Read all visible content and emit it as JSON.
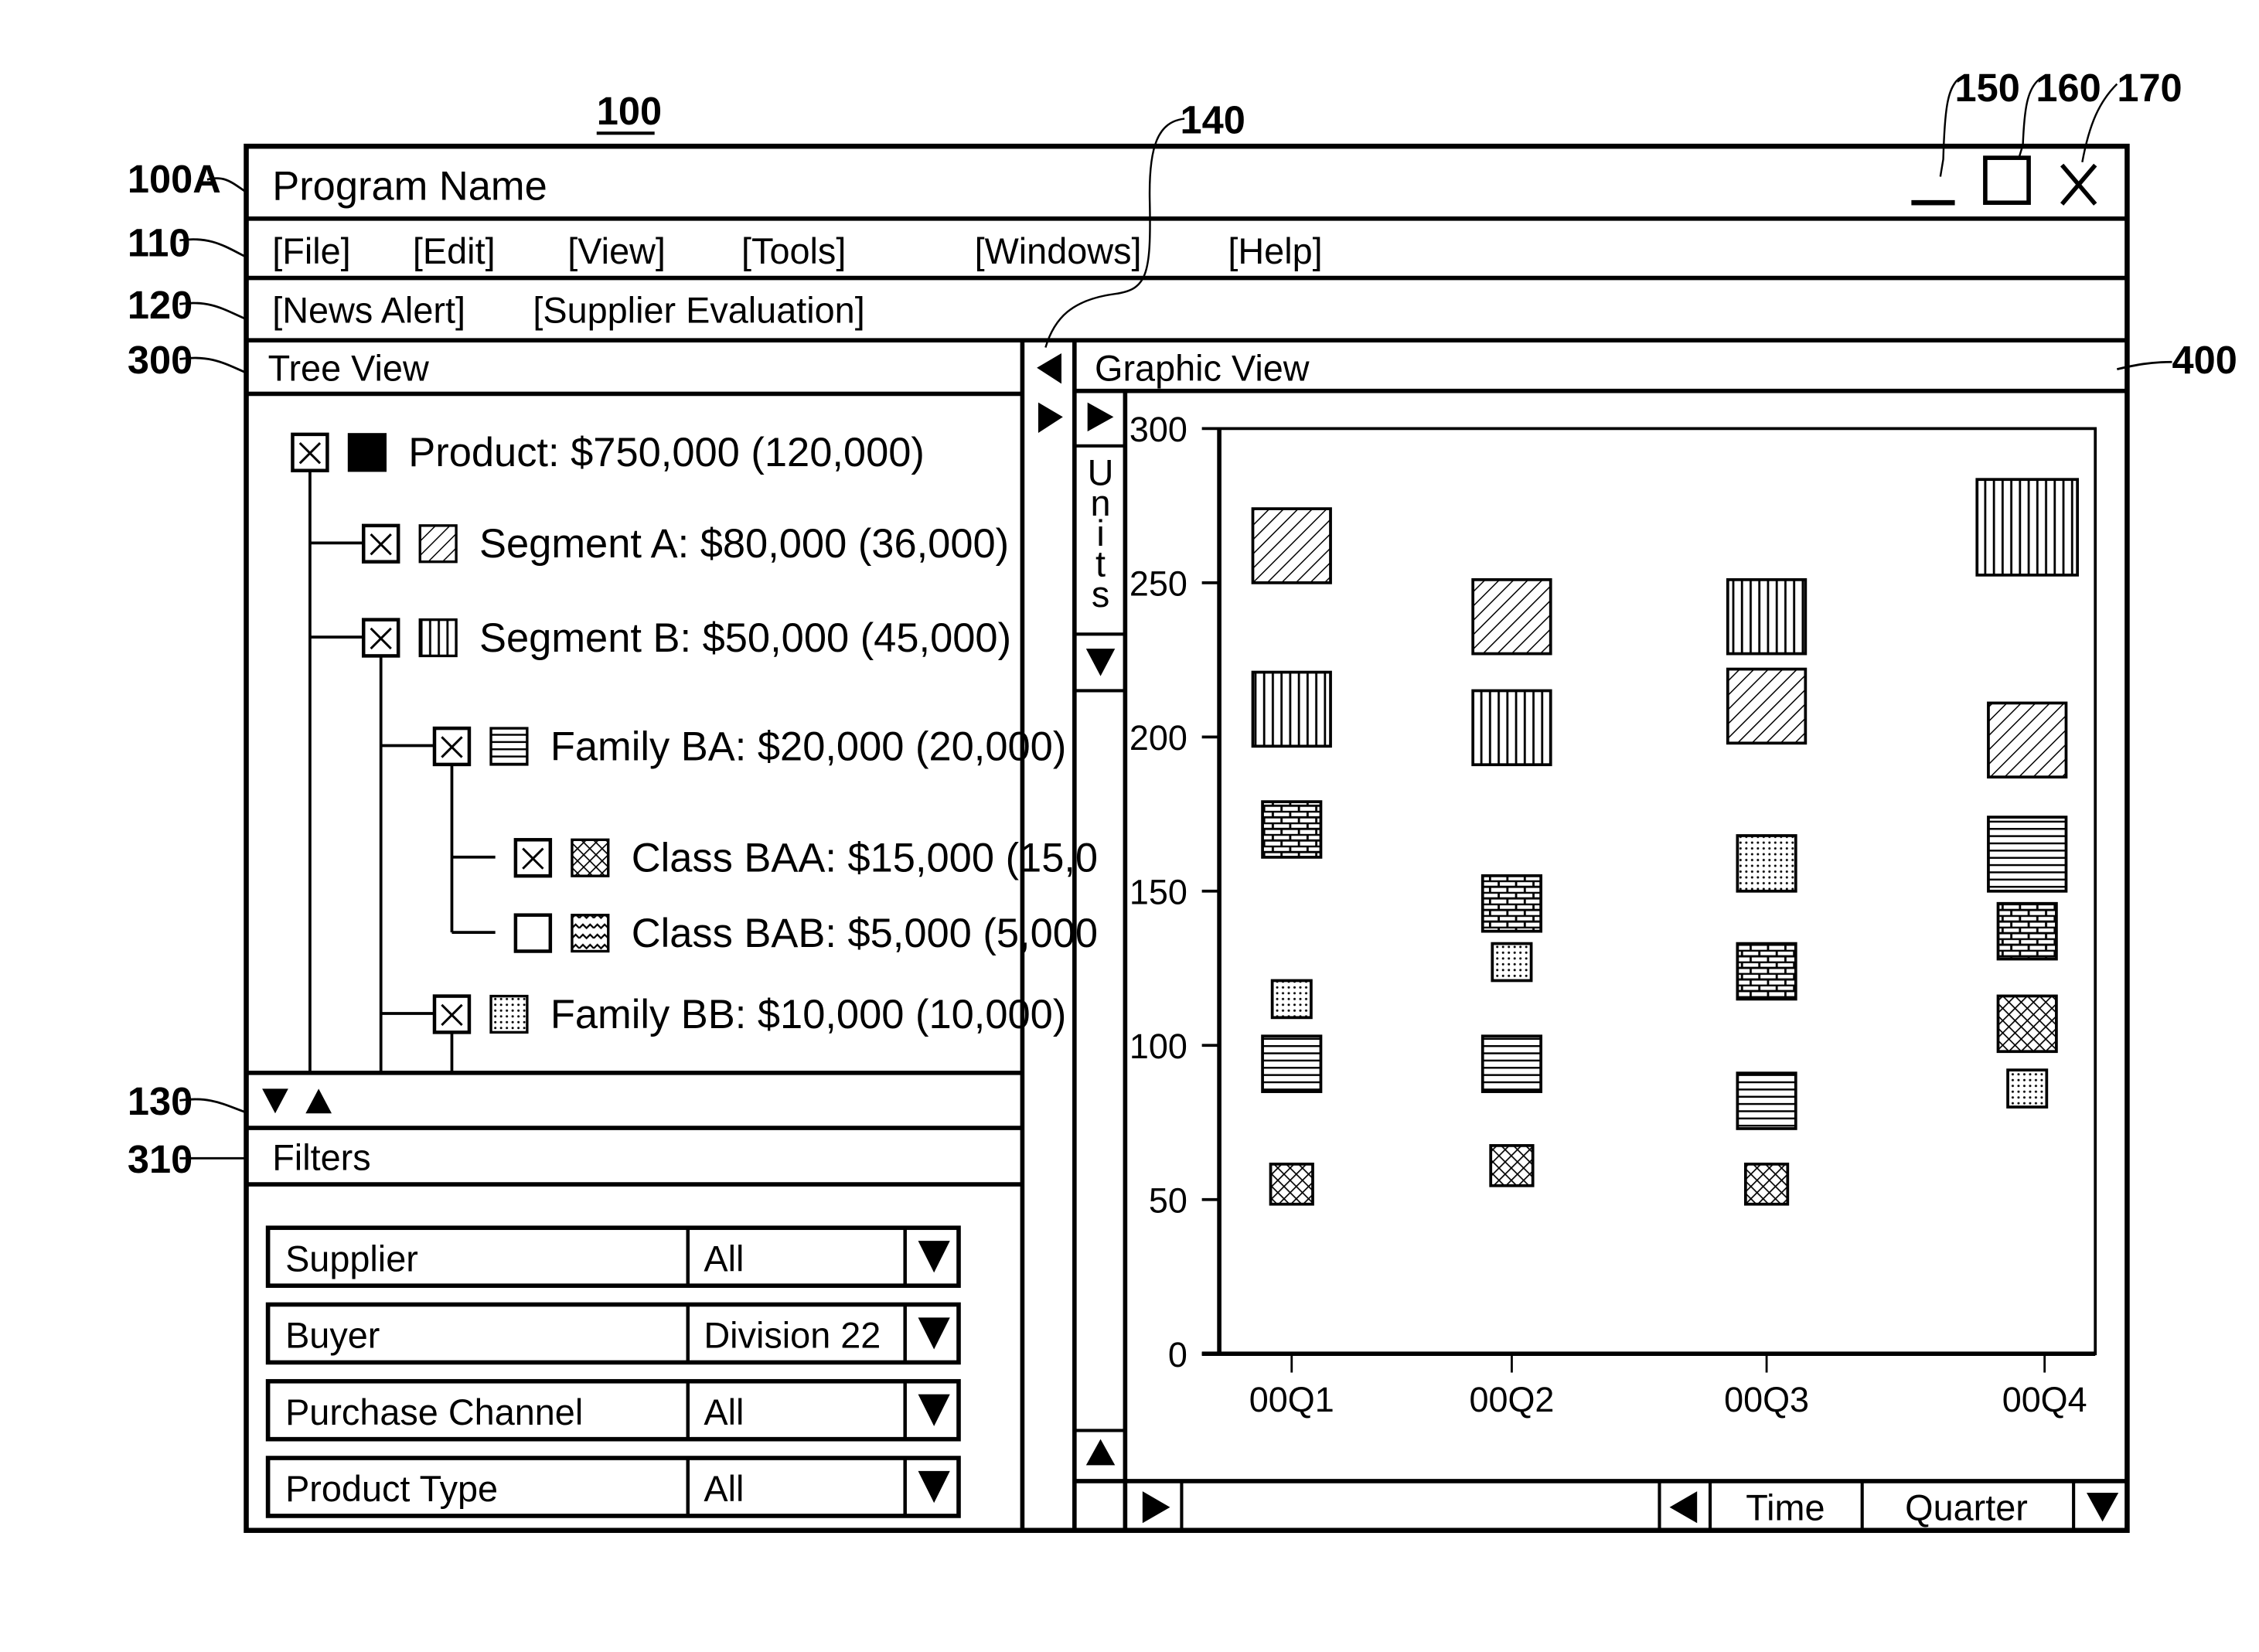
{
  "figure_refs": {
    "window": "100",
    "title_bar": "100A",
    "menu_bar": "110",
    "toolbar": "120",
    "splitter": "140",
    "minimize": "150",
    "maximize": "160",
    "close": "170",
    "tree_scroll": "130",
    "tree_view": "300",
    "filters": "310",
    "graphic_view": "400"
  },
  "window": {
    "title": "Program Name",
    "controls": {
      "minimize_icon": "minimize-icon",
      "maximize_icon": "maximize-icon",
      "close_icon": "close-icon"
    }
  },
  "menu": {
    "items": [
      "[File]",
      "[Edit]",
      "[View]",
      "[Tools]",
      "[Windows]",
      "[Help]"
    ]
  },
  "toolbar": {
    "items": [
      "[News Alert]",
      "[Supplier Evaluation]"
    ]
  },
  "tree_view": {
    "title": "Tree View",
    "nodes": [
      {
        "label": "Product:",
        "value": "$750,000",
        "units": "(120,000)",
        "checked": true,
        "pattern": "solid",
        "level": 0
      },
      {
        "label": "Segment A:",
        "value": "$80,000",
        "units": "(36,000)",
        "checked": true,
        "pattern": "diagonal",
        "level": 1
      },
      {
        "label": "Segment B:",
        "value": "$50,000",
        "units": "(45,000)",
        "checked": true,
        "pattern": "vertical",
        "level": 1
      },
      {
        "label": "Family BA:",
        "value": "$20,000",
        "units": "(20,000)",
        "checked": true,
        "pattern": "horizontal",
        "level": 2
      },
      {
        "label": "Class BAA:",
        "value": "$15,000",
        "units": "(15,0",
        "checked": true,
        "pattern": "crosshatch",
        "level": 3
      },
      {
        "label": "Class BAB:",
        "value": "$5,000",
        "units": "(5,000",
        "checked": false,
        "pattern": "wavy",
        "level": 3
      },
      {
        "label": "Family BB:",
        "value": "$10,000",
        "units": "(10,000)",
        "checked": true,
        "pattern": "dots",
        "level": 2
      }
    ],
    "scroll_down_icon": "triangle-down-icon",
    "scroll_up_icon": "triangle-up-icon"
  },
  "filters": {
    "title": "Filters",
    "rows": [
      {
        "label": "Supplier",
        "value": "All"
      },
      {
        "label": "Buyer",
        "value": "Division 22"
      },
      {
        "label": "Purchase Channel",
        "value": "All"
      },
      {
        "label": "Product Type",
        "value": "All"
      }
    ]
  },
  "graphic_view": {
    "title": "Graphic View",
    "y_axis_selector": "Units",
    "x_axis_dimension": "Time",
    "x_axis_granularity": "Quarter"
  },
  "chart_data": {
    "type": "scatter",
    "title": "",
    "xlabel": "Time",
    "ylabel": "Units",
    "categories": [
      "00Q1",
      "00Q2",
      "00Q3",
      "00Q4"
    ],
    "y_ticks": [
      "0",
      "50",
      "100",
      "150",
      "200",
      "250",
      "300"
    ],
    "ylim": [
      0,
      300
    ],
    "grid": false,
    "legend": "tree-view",
    "marker": "patterned-square (marker size varies)",
    "series": [
      {
        "name": "Segment A",
        "pattern": "diagonal",
        "values": [
          262,
          239,
          210,
          199
        ],
        "sizes": [
          24,
          24,
          24,
          24
        ]
      },
      {
        "name": "Segment B",
        "pattern": "vertical",
        "values": [
          209,
          203,
          239,
          268
        ],
        "sizes": [
          24,
          24,
          24,
          31
        ]
      },
      {
        "name": "Brick pattern",
        "pattern": "brick",
        "values": [
          170,
          146,
          124,
          137
        ],
        "sizes": [
          18,
          18,
          18,
          18
        ]
      },
      {
        "name": "Family BB",
        "pattern": "dots",
        "values": [
          115,
          127,
          159,
          86
        ],
        "sizes": [
          12,
          12,
          18,
          12
        ]
      },
      {
        "name": "Family BA",
        "pattern": "horizontal",
        "values": [
          94,
          94,
          82,
          162
        ],
        "sizes": [
          18,
          18,
          18,
          24
        ]
      },
      {
        "name": "Class BAA",
        "pattern": "crosshatch",
        "values": [
          55,
          61,
          55,
          107
        ],
        "sizes": [
          13,
          13,
          13,
          18
        ]
      }
    ]
  }
}
